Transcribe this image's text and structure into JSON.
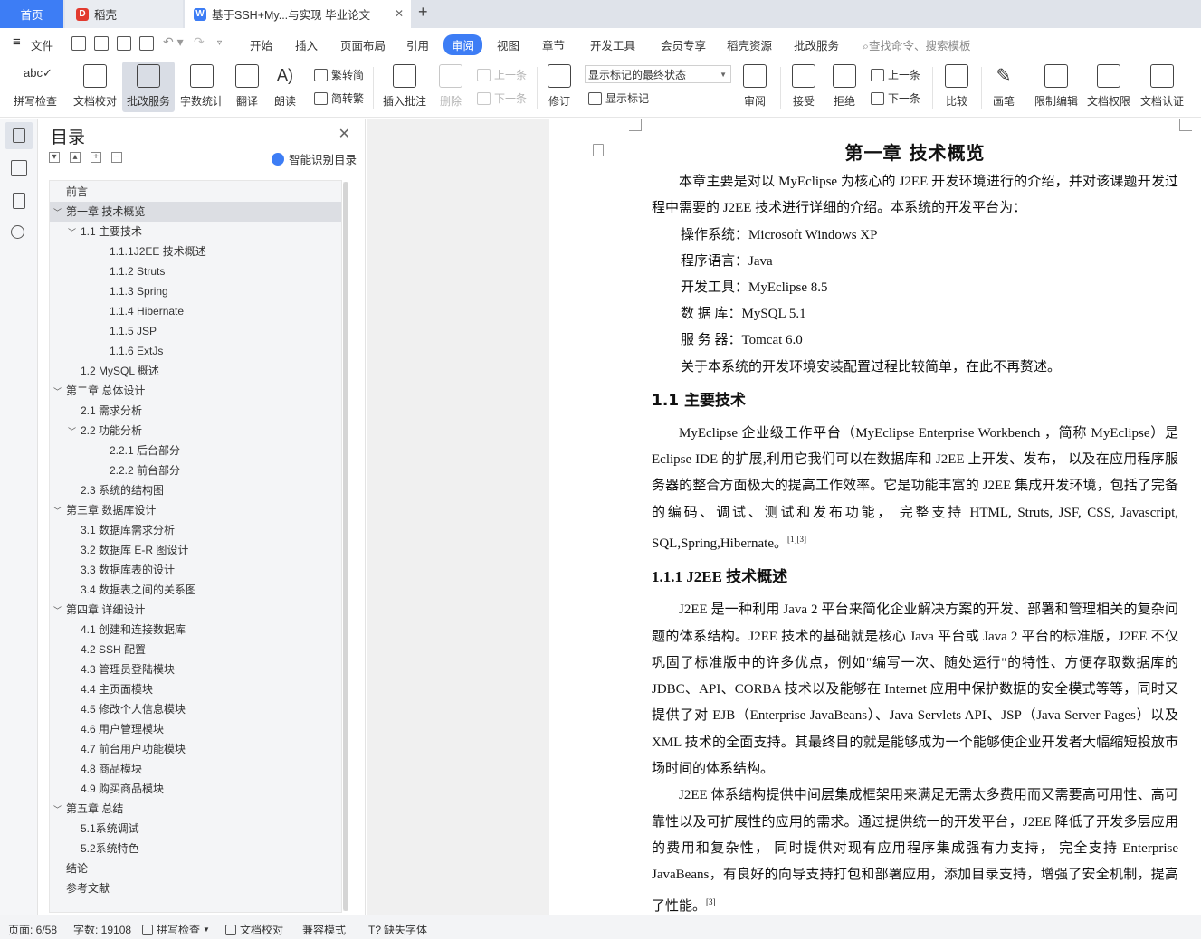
{
  "tabs": [
    {
      "label": "首页"
    },
    {
      "label": "稻壳"
    },
    {
      "label": "基于SSH+My...与实现 毕业论文"
    }
  ],
  "menu": {
    "file": "文件",
    "items": [
      "开始",
      "插入",
      "页面布局",
      "引用",
      "审阅",
      "视图",
      "章节",
      "开发工具",
      "会员专享",
      "稻壳资源",
      "批改服务"
    ],
    "active": "审阅",
    "search_placeholder": "查找命令、搜索模板"
  },
  "toolbar": {
    "spell_check": "拼写检查",
    "doc_proof": "文档校对",
    "correction_service": "批改服务",
    "word_count": "字数统计",
    "translate": "翻译",
    "read_aloud": "朗读",
    "trad_to_simp": "繁转简",
    "simp_to_trad": "简转繁",
    "insert_comment": "插入批注",
    "delete": "删除",
    "prev": "上一条",
    "next": "下一条",
    "track_changes": "修订",
    "markup_select": "显示标记的最终状态",
    "show_markup": "显示标记",
    "review": "审阅",
    "accept": "接受",
    "reject": "拒绝",
    "prev2": "上一条",
    "next2": "下一条",
    "compare": "比较",
    "pen": "画笔",
    "restrict_edit": "限制编辑",
    "doc_permission": "文档权限",
    "doc_cert": "文档认证"
  },
  "toc": {
    "title": "目录",
    "smart": "智能识别目录",
    "items": [
      {
        "label": "前言",
        "level": 1,
        "arrow": ""
      },
      {
        "label": "第一章  技术概览",
        "level": 1,
        "arrow": "v"
      },
      {
        "label": "1.1  主要技术",
        "level": 2,
        "arrow": "v"
      },
      {
        "label": "1.1.1J2EE 技术概述",
        "level": 3,
        "arrow": ""
      },
      {
        "label": "1.1.2 Struts",
        "level": 3,
        "arrow": ""
      },
      {
        "label": "1.1.3 Spring",
        "level": 3,
        "arrow": ""
      },
      {
        "label": "1.1.4 Hibernate",
        "level": 3,
        "arrow": ""
      },
      {
        "label": "1.1.5 JSP",
        "level": 3,
        "arrow": ""
      },
      {
        "label": "1.1.6 ExtJs",
        "level": 3,
        "arrow": ""
      },
      {
        "label": "1.2 MySQL 概述",
        "level": 2,
        "arrow": ""
      },
      {
        "label": "第二章  总体设计",
        "level": 1,
        "arrow": "v"
      },
      {
        "label": "2.1  需求分析",
        "level": 2,
        "arrow": ""
      },
      {
        "label": "2.2  功能分析",
        "level": 2,
        "arrow": "v"
      },
      {
        "label": "2.2.1  后台部分",
        "level": 3,
        "arrow": ""
      },
      {
        "label": "2.2.2  前台部分",
        "level": 3,
        "arrow": ""
      },
      {
        "label": "2.3  系统的结构图",
        "level": 2,
        "arrow": ""
      },
      {
        "label": "第三章  数据库设计",
        "level": 1,
        "arrow": "v"
      },
      {
        "label": "3.1  数据库需求分析",
        "level": 2,
        "arrow": ""
      },
      {
        "label": "3.2  数据库 E-R 图设计",
        "level": 2,
        "arrow": ""
      },
      {
        "label": "3.3  数据库表的设计",
        "level": 2,
        "arrow": ""
      },
      {
        "label": "3.4  数据表之间的关系图",
        "level": 2,
        "arrow": ""
      },
      {
        "label": "第四章  详细设计",
        "level": 1,
        "arrow": "v"
      },
      {
        "label": "4.1  创建和连接数据库",
        "level": 2,
        "arrow": ""
      },
      {
        "label": "4.2 SSH 配置",
        "level": 2,
        "arrow": ""
      },
      {
        "label": "4.3  管理员登陆模块",
        "level": 2,
        "arrow": ""
      },
      {
        "label": "4.4 主页面模块",
        "level": 2,
        "arrow": ""
      },
      {
        "label": "4.5  修改个人信息模块",
        "level": 2,
        "arrow": ""
      },
      {
        "label": "4.6  用户管理模块",
        "level": 2,
        "arrow": ""
      },
      {
        "label": "4.7  前台用户功能模块",
        "level": 2,
        "arrow": ""
      },
      {
        "label": "4.8  商品模块",
        "level": 2,
        "arrow": ""
      },
      {
        "label": "4.9  购买商品模块",
        "level": 2,
        "arrow": ""
      },
      {
        "label": "第五章  总结",
        "level": 1,
        "arrow": "v"
      },
      {
        "label": "5.1系统调试",
        "level": 2,
        "arrow": ""
      },
      {
        "label": "5.2系统特色",
        "level": 2,
        "arrow": ""
      },
      {
        "label": "结论",
        "level": 1,
        "arrow": ""
      },
      {
        "label": "参考文献",
        "level": 1,
        "arrow": ""
      }
    ],
    "selected_index": 1
  },
  "doc": {
    "title": "第一章  技术概览",
    "p1": "本章主要是对以 MyEclipse 为核心的 J2EE 开发环境进行的介绍，并对该课题开发过程中需要的 J2EE 技术进行详细的介绍。本系统的开发平台为：",
    "env": [
      "操作系统：Microsoft Windows XP",
      "程序语言：Java",
      "开发工具：MyEclipse 8.5",
      "数  据  库：MySQL 5.1",
      "服  务  器：Tomcat 6.0",
      "关于本系统的开发环境安装配置过程比较简单，在此不再赘述。"
    ],
    "h_1_1": "1.1  主要技术",
    "p2": "MyEclipse 企业级工作平台（MyEclipse Enterprise Workbench ，简称 MyEclipse）是 Eclipse IDE 的扩展,利用它我们可以在数据库和 J2EE 上开发、发布， 以及在应用程序服务器的整合方面极大的提高工作效率。它是功能丰富的 J2EE 集成开发环境，包括了完备的编码、调试、测试和发布功能， 完整支持 HTML, Struts, JSF, CSS, Javascript, SQL,Spring,Hibernate。",
    "p2_ref": "[1][3]",
    "h_1_1_1": "1.1.1  J2EE 技术概述",
    "p3": "J2EE 是一种利用 Java 2 平台来简化企业解决方案的开发、部署和管理相关的复杂问题的体系结构。J2EE 技术的基础就是核心 Java 平台或 Java 2 平台的标准版，J2EE 不仅巩固了标准版中的许多优点，例如\"编写一次、随处运行\"的特性、方便存取数据库的 JDBC、API、CORBA 技术以及能够在 Internet 应用中保护数据的安全模式等等，同时又提供了对  EJB（Enterprise JavaBeans）、Java Servlets API、JSP（Java Server Pages）以及 XML 技术的全面支持。其最终目的就是能够成为一个能够使企业开发者大幅缩短投放市场时间的体系结构。",
    "p4": "J2EE 体系结构提供中间层集成框架用来满足无需太多费用而又需要高可用性、高可靠性以及可扩展性的应用的需求。通过提供统一的开发平台，J2EE 降低了开发多层应用的费用和复杂性， 同时提供对现有应用程序集成强有力支持， 完全支持 Enterprise JavaBeans，有良好的向导支持打包和部署应用，添加目录支持，增强了安全机制，提高了性能。",
    "p4_ref": "[3]"
  },
  "status": {
    "page": "页面: 6/58",
    "words": "字数: 19108",
    "spell": "拼写检查",
    "proof": "文档校对",
    "compat": "兼容模式",
    "missing_font": "缺失字体"
  },
  "colors": {
    "accent": "#3d7df5",
    "selected_row": "#dcdee3",
    "workspace": "#f0f0f0"
  }
}
